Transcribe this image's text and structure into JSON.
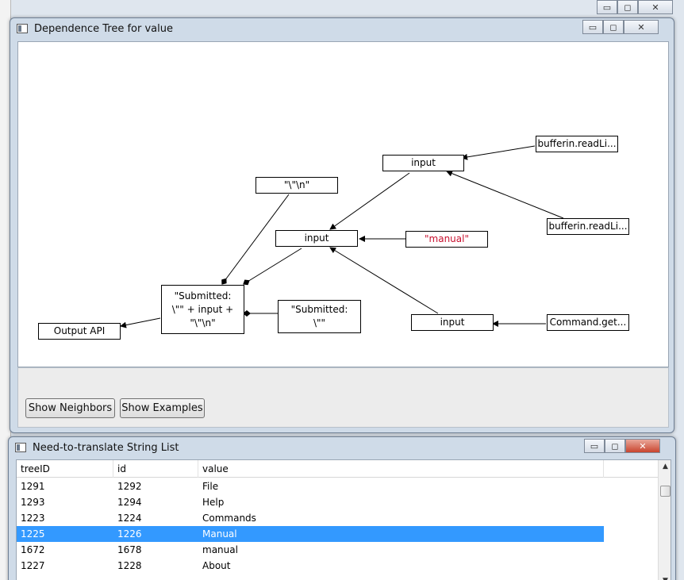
{
  "colors": {
    "selection": "#3399ff",
    "highlight_text": "#c8102e"
  },
  "tree_window": {
    "title": "Dependence Tree for value",
    "controls": {
      "minimize": "▭",
      "maximize": "◻",
      "close": "✕"
    },
    "nodes": {
      "input_top": "input",
      "bufferin_1": "bufferin.readLi...",
      "newline_lit": "\"\\\"\\n\"",
      "input_mid": "input",
      "manual": "\"manual\"",
      "bufferin_2": "bufferin.readLi...",
      "submitted_concat": "\"Submitted:\n\\\"\" + input +\n\"\\\"\\n\"",
      "submitted_lit": "\"Submitted:\n\\\"\"",
      "output_api": "Output API",
      "input_bottom": "input",
      "command_get": "Command.get..."
    },
    "buttons": {
      "show_neighbors": "Show Neighbors",
      "show_examples": "Show Examples"
    }
  },
  "list_window": {
    "title": "Need-to-translate String List",
    "controls": {
      "minimize": "▭",
      "maximize": "◻",
      "close": "✕"
    },
    "columns": [
      "treeID",
      "id",
      "value"
    ],
    "rows": [
      {
        "treeID": "1291",
        "id": "1292",
        "value": "File",
        "selected": false
      },
      {
        "treeID": "1293",
        "id": "1294",
        "value": "Help",
        "selected": false
      },
      {
        "treeID": "1223",
        "id": "1224",
        "value": "Commands",
        "selected": false
      },
      {
        "treeID": "1225",
        "id": "1226",
        "value": "Manual",
        "selected": true
      },
      {
        "treeID": "1672",
        "id": "1678",
        "value": "manual",
        "selected": false
      },
      {
        "treeID": "1227",
        "id": "1228",
        "value": "About",
        "selected": false
      }
    ]
  },
  "outer_controls": {
    "minimize": "▭",
    "maximize": "◻",
    "close": "✕"
  }
}
